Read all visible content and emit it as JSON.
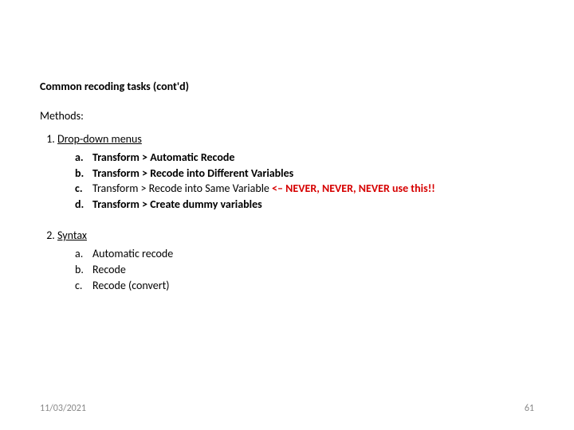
{
  "title": "Common recoding tasks (cont'd)",
  "methods_label": "Methods:",
  "list1": {
    "num": "1.",
    "head": "Drop-down menus",
    "a_marker": "a.",
    "a_text": "Transform > Automatic Recode",
    "b_marker": "b.",
    "b_text": "Transform > Recode into Different Variables",
    "c_marker": "c.",
    "c_text_pre": "Transform > Recode into Same Variable ",
    "c_text_warn": "<– NEVER, NEVER, NEVER use this!!",
    "d_marker": "d.",
    "d_text": "Transform > Create dummy variables"
  },
  "list2": {
    "num": "2.",
    "head": "Syntax",
    "a_marker": "a.",
    "a_text": "Automatic recode",
    "b_marker": "b.",
    "b_text": "Recode",
    "c_marker": "c.",
    "c_text": "Recode (convert)"
  },
  "footer": {
    "date": "11/03/2021",
    "page": "61"
  }
}
